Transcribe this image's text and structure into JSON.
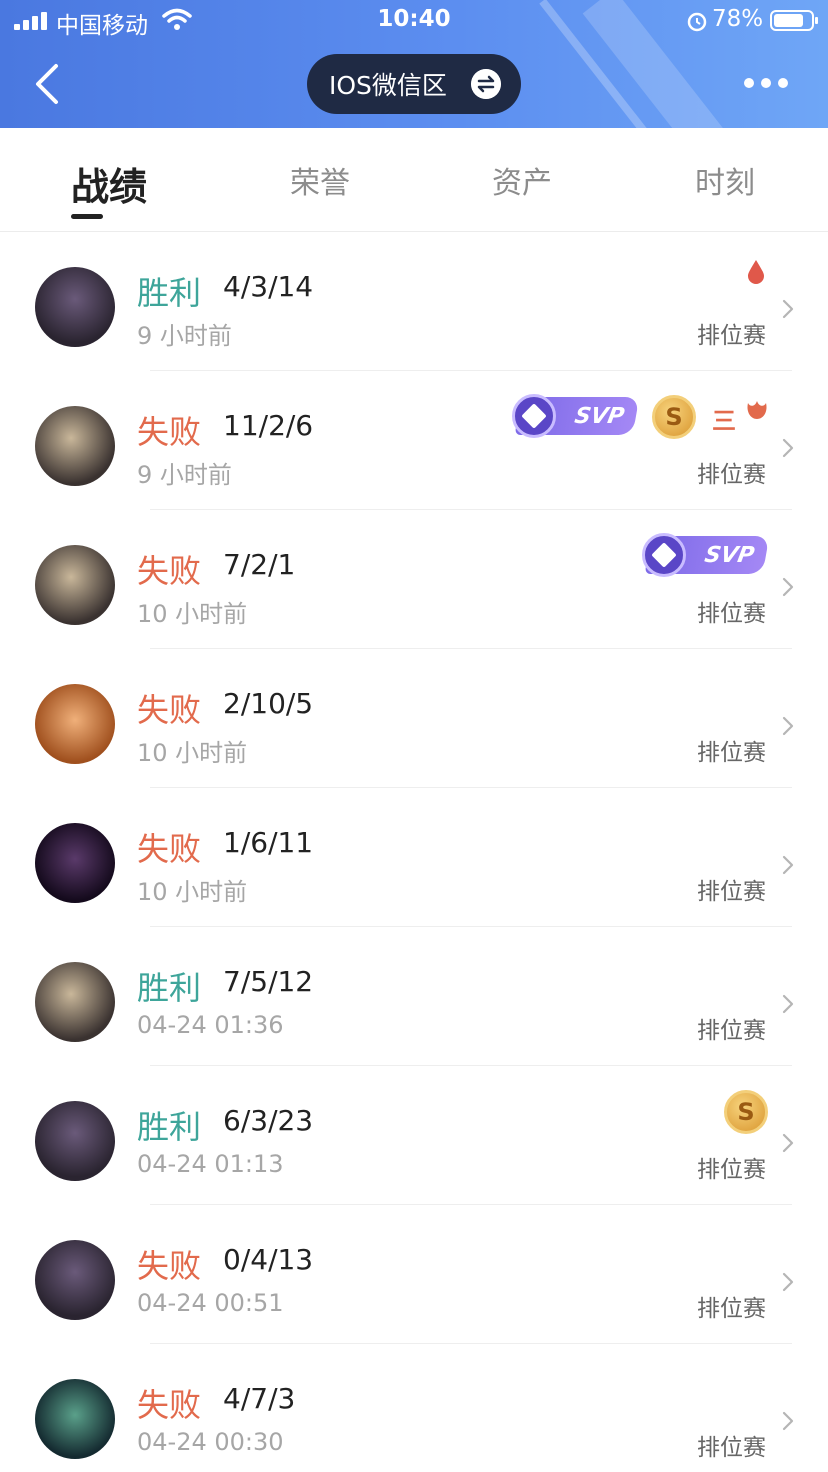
{
  "status_bar": {
    "carrier": "中国移动",
    "time": "10:40",
    "battery": "78%"
  },
  "header": {
    "server_label": "IOS微信区"
  },
  "tabs": [
    {
      "label": "战绩",
      "active": true
    },
    {
      "label": "荣誉",
      "active": false
    },
    {
      "label": "资产",
      "active": false
    },
    {
      "label": "时刻",
      "active": false
    }
  ],
  "matches": [
    {
      "result": "胜利",
      "outcome": "win",
      "kda": "4/3/14",
      "time": "9 小时前",
      "mode": "排位赛",
      "badges": [
        "blood-drop"
      ]
    },
    {
      "result": "失败",
      "outcome": "lose",
      "kda": "11/2/6",
      "time": "9 小时前",
      "mode": "排位赛",
      "badges": [
        "svp",
        "s-rank",
        "triple",
        "fire"
      ]
    },
    {
      "result": "失败",
      "outcome": "lose",
      "kda": "7/2/1",
      "time": "10 小时前",
      "mode": "排位赛",
      "badges": [
        "svp"
      ]
    },
    {
      "result": "失败",
      "outcome": "lose",
      "kda": "2/10/5",
      "time": "10 小时前",
      "mode": "排位赛",
      "badges": []
    },
    {
      "result": "失败",
      "outcome": "lose",
      "kda": "1/6/11",
      "time": "10 小时前",
      "mode": "排位赛",
      "badges": []
    },
    {
      "result": "胜利",
      "outcome": "win",
      "kda": "7/5/12",
      "time": "04-24 01:36",
      "mode": "排位赛",
      "badges": []
    },
    {
      "result": "胜利",
      "outcome": "win",
      "kda": "6/3/23",
      "time": "04-24 01:13",
      "mode": "排位赛",
      "badges": [
        "s-rank"
      ]
    },
    {
      "result": "失败",
      "outcome": "lose",
      "kda": "0/4/13",
      "time": "04-24 00:51",
      "mode": "排位赛",
      "badges": []
    },
    {
      "result": "失败",
      "outcome": "lose",
      "kda": "4/7/3",
      "time": "04-24 00:30",
      "mode": "排位赛",
      "badges": []
    }
  ],
  "badge_text": {
    "svp": "SVP",
    "s_rank": "S",
    "triple": "三"
  },
  "colors": {
    "win": "#3ea59a",
    "lose": "#e26a4c",
    "header_start": "#4a78e0",
    "header_end": "#6fa6f6"
  }
}
